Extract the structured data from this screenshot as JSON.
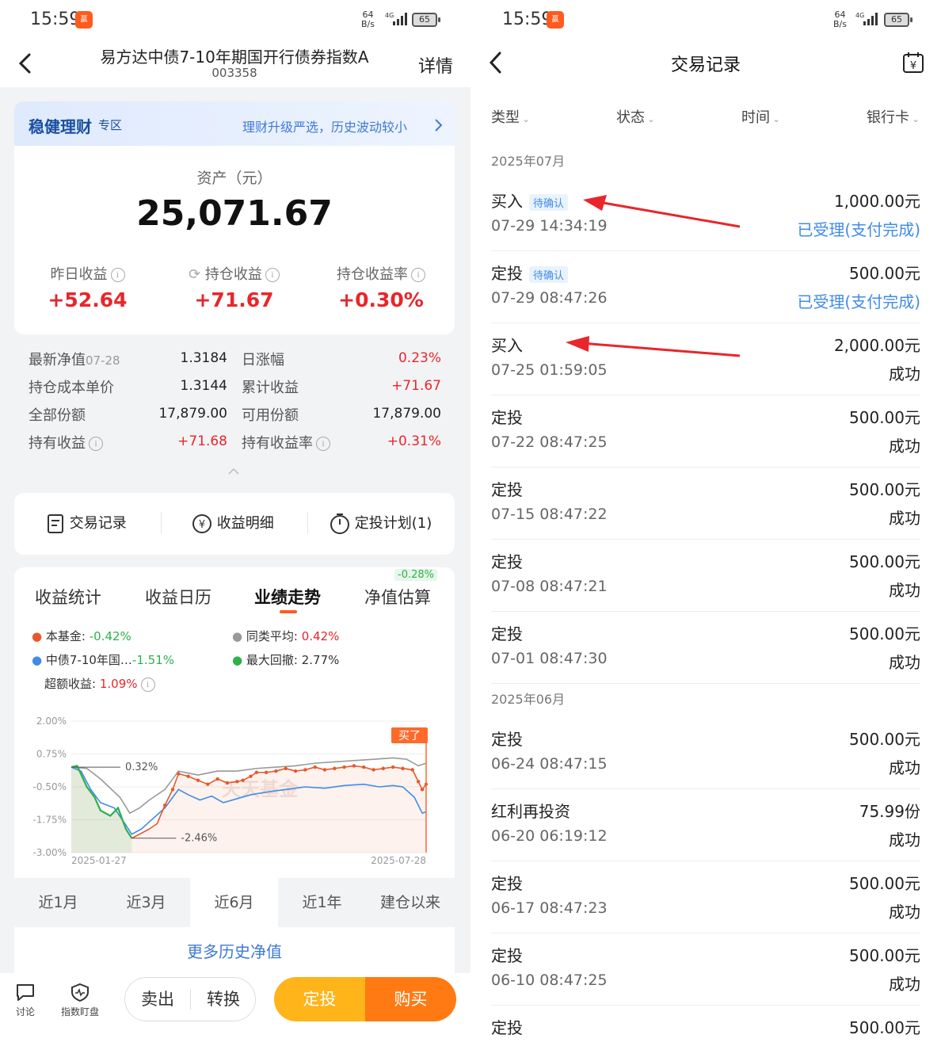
{
  "left": {
    "status": {
      "time": "15:59",
      "app_badge": "赢",
      "net_top": "64",
      "net_bottom": "B/s",
      "sig_label": "4G",
      "battery": "65"
    },
    "header": {
      "title": "易方达中债7-10年期国开行债券指数A",
      "code": "003358",
      "detail": "详情"
    },
    "banner": {
      "title": "稳健理财",
      "tag": "专区",
      "slogan": "理财升级严选，历史波动较小"
    },
    "asset": {
      "label": "资产（元）",
      "value": "25,071.67",
      "stats": [
        {
          "label": "昨日收益",
          "value": "+52.64"
        },
        {
          "label": "持仓收益",
          "value": "+71.67"
        },
        {
          "label": "持仓收益率",
          "value": "+0.30%"
        }
      ]
    },
    "details": [
      {
        "label": "最新净值",
        "sub": "07-28",
        "value": "1.3184",
        "label2": "日涨幅",
        "value2": "0.23%"
      },
      {
        "label": "持仓成本单价",
        "sub": "",
        "value": "1.3144",
        "label2": "累计收益",
        "value2": "+71.67"
      },
      {
        "label": "全部份额",
        "sub": "",
        "value": "17,879.00",
        "label2": "可用份额",
        "value2": "17,879.00"
      },
      {
        "label": "持有收益",
        "sub": "",
        "value": "+71.68",
        "label2": "持有收益率",
        "value2": "+0.31%"
      }
    ],
    "actions": [
      {
        "label": "交易记录",
        "icon": "receipt-icon"
      },
      {
        "label": "收益明细",
        "icon": "yen-circle-icon"
      },
      {
        "label": "定投计划(1)",
        "icon": "timer-icon"
      }
    ],
    "tabs": [
      {
        "label": "收益统计"
      },
      {
        "label": "收益日历"
      },
      {
        "label": "业绩走势"
      },
      {
        "label": "净值估算",
        "badge": "-0.28%"
      }
    ],
    "active_tab": "业绩走势",
    "legend": [
      {
        "name": "本基金",
        "value": "-0.42%",
        "color": "#e8572b"
      },
      {
        "name": "同类平均",
        "value": "0.42%",
        "color": "#999999"
      },
      {
        "name": "中债7-10年国…",
        "value": "-1.51%",
        "color": "#3f8ce8"
      },
      {
        "name": "最大回撤",
        "value": "2.77%",
        "color": "#2db14a"
      }
    ],
    "excess": {
      "label": "超额收益:",
      "value": "1.09%"
    },
    "chart_data": {
      "type": "line",
      "yticks": [
        "2.00%",
        "0.75%",
        "-0.50%",
        "-1.75%",
        "-3.00%"
      ],
      "ylim": [
        -3.0,
        2.0
      ],
      "xlim": [
        "2025-01-27",
        "2025-07-28"
      ],
      "xticks": [
        "2025-01-27",
        "2025-07-28"
      ],
      "annotations": {
        "high": "0.32%",
        "low": "-2.46%",
        "buy": "买了"
      },
      "watermark": "天天基金",
      "series": [
        {
          "name": "本基金",
          "color": "#e8572b",
          "points": [
            [
              0,
              0.25
            ],
            [
              3,
              0.3
            ],
            [
              8,
              -0.5
            ],
            [
              12,
              -0.9
            ],
            [
              15,
              -1.4
            ],
            [
              20,
              -1.6
            ],
            [
              24,
              -1.3
            ],
            [
              28,
              -2.1
            ],
            [
              31,
              -2.45
            ],
            [
              35,
              -2.3
            ],
            [
              40,
              -2.1
            ],
            [
              44,
              -1.9
            ],
            [
              48,
              -1.2
            ],
            [
              52,
              -0.6
            ],
            [
              55,
              0.0
            ],
            [
              60,
              -0.1
            ],
            [
              65,
              -0.25
            ],
            [
              70,
              -0.4
            ],
            [
              75,
              -0.2
            ],
            [
              80,
              -0.35
            ],
            [
              85,
              -0.3
            ],
            [
              88,
              -0.25
            ],
            [
              92,
              -0.1
            ],
            [
              95,
              0.05
            ],
            [
              100,
              0.05
            ],
            [
              105,
              0.1
            ],
            [
              110,
              0.2
            ],
            [
              115,
              0.1
            ],
            [
              120,
              0.15
            ],
            [
              125,
              0.25
            ],
            [
              130,
              0.15
            ],
            [
              135,
              0.2
            ],
            [
              140,
              0.25
            ],
            [
              145,
              0.3
            ],
            [
              150,
              0.25
            ],
            [
              155,
              0.15
            ],
            [
              160,
              0.2
            ],
            [
              165,
              0.25
            ],
            [
              170,
              0.2
            ],
            [
              175,
              0.15
            ],
            [
              178,
              -0.3
            ],
            [
              180,
              -0.6
            ],
            [
              182,
              -0.4
            ]
          ]
        },
        {
          "name": "同类平均",
          "color": "#999999",
          "points": [
            [
              0,
              0.25
            ],
            [
              8,
              0.2
            ],
            [
              15,
              -0.2
            ],
            [
              25,
              -0.9
            ],
            [
              30,
              -1.5
            ],
            [
              35,
              -1.3
            ],
            [
              40,
              -1.0
            ],
            [
              48,
              -0.6
            ],
            [
              52,
              -0.2
            ],
            [
              55,
              0.1
            ],
            [
              65,
              -0.05
            ],
            [
              75,
              0.1
            ],
            [
              85,
              0.1
            ],
            [
              95,
              0.2
            ],
            [
              105,
              0.25
            ],
            [
              115,
              0.3
            ],
            [
              125,
              0.4
            ],
            [
              135,
              0.45
            ],
            [
              145,
              0.5
            ],
            [
              155,
              0.55
            ],
            [
              165,
              0.6
            ],
            [
              172,
              0.55
            ],
            [
              178,
              0.3
            ],
            [
              182,
              0.4
            ]
          ]
        },
        {
          "name": "中债7-10年国…",
          "color": "#3f8ce8",
          "points": [
            [
              0,
              0.25
            ],
            [
              5,
              0.1
            ],
            [
              10,
              -0.6
            ],
            [
              15,
              -1.1
            ],
            [
              22,
              -1.3
            ],
            [
              28,
              -1.95
            ],
            [
              31,
              -2.3
            ],
            [
              36,
              -2.1
            ],
            [
              42,
              -1.7
            ],
            [
              48,
              -1.3
            ],
            [
              52,
              -0.9
            ],
            [
              55,
              -0.6
            ],
            [
              60,
              -0.8
            ],
            [
              66,
              -1.0
            ],
            [
              72,
              -0.85
            ],
            [
              78,
              -1.1
            ],
            [
              85,
              -0.95
            ],
            [
              92,
              -0.8
            ],
            [
              100,
              -0.7
            ],
            [
              110,
              -0.6
            ],
            [
              120,
              -0.5
            ],
            [
              130,
              -0.55
            ],
            [
              140,
              -0.45
            ],
            [
              150,
              -0.4
            ],
            [
              158,
              -0.5
            ],
            [
              165,
              -0.45
            ],
            [
              170,
              -0.5
            ],
            [
              176,
              -0.9
            ],
            [
              180,
              -1.5
            ],
            [
              182,
              -1.45
            ]
          ]
        }
      ]
    },
    "periods": [
      "近1月",
      "近3月",
      "近6月",
      "近1年",
      "建仓以来"
    ],
    "active_period": "近6月",
    "more_link": "更多历史净值",
    "bottom": {
      "discuss": "讨论",
      "index_watch": "指数盯盘",
      "sell": "卖出",
      "convert": "转换",
      "sip": "定投",
      "buy": "购买"
    }
  },
  "right": {
    "status": {
      "time": "15:59",
      "app_badge": "赢",
      "net_top": "64",
      "net_bottom": "B/s",
      "sig_label": "4G",
      "battery": "65"
    },
    "header": {
      "title": "交易记录"
    },
    "filters": [
      "类型",
      "状态",
      "时间",
      "银行卡"
    ],
    "groups": [
      {
        "month": "2025年07月",
        "items": [
          {
            "type": "买入",
            "badge": "待确认",
            "time": "07-29 14:34:19",
            "amount": "1,000.00元",
            "status": "已受理(支付完成)",
            "pending": true
          },
          {
            "type": "定投",
            "badge": "待确认",
            "time": "07-29 08:47:26",
            "amount": "500.00元",
            "status": "已受理(支付完成)",
            "pending": true
          },
          {
            "type": "买入",
            "badge": "",
            "time": "07-25 01:59:05",
            "amount": "2,000.00元",
            "status": "成功",
            "pending": false
          },
          {
            "type": "定投",
            "badge": "",
            "time": "07-22 08:47:25",
            "amount": "500.00元",
            "status": "成功",
            "pending": false
          },
          {
            "type": "定投",
            "badge": "",
            "time": "07-15 08:47:22",
            "amount": "500.00元",
            "status": "成功",
            "pending": false
          },
          {
            "type": "定投",
            "badge": "",
            "time": "07-08 08:47:21",
            "amount": "500.00元",
            "status": "成功",
            "pending": false
          },
          {
            "type": "定投",
            "badge": "",
            "time": "07-01 08:47:30",
            "amount": "500.00元",
            "status": "成功",
            "pending": false
          }
        ]
      },
      {
        "month": "2025年06月",
        "items": [
          {
            "type": "定投",
            "badge": "",
            "time": "06-24 08:47:15",
            "amount": "500.00元",
            "status": "成功",
            "pending": false
          },
          {
            "type": "红利再投资",
            "badge": "",
            "time": "06-20 06:19:12",
            "amount": "75.99份",
            "status": "成功",
            "pending": false
          },
          {
            "type": "定投",
            "badge": "",
            "time": "06-17 08:47:23",
            "amount": "500.00元",
            "status": "成功",
            "pending": false
          },
          {
            "type": "定投",
            "badge": "",
            "time": "06-10 08:47:25",
            "amount": "500.00元",
            "status": "成功",
            "pending": false
          },
          {
            "type": "定投",
            "badge": "",
            "time": "",
            "amount": "500.00元",
            "status": "",
            "pending": false
          }
        ]
      }
    ]
  }
}
